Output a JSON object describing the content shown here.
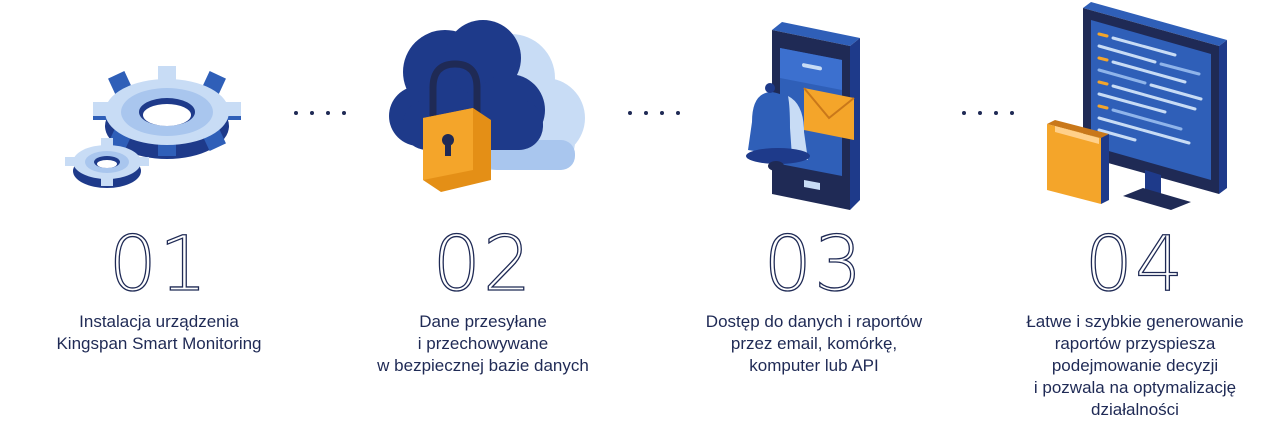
{
  "steps": [
    {
      "number": "01",
      "icon": "gears-icon",
      "lines": [
        "Instalacja urządzenia",
        "Kingspan Smart Monitoring"
      ]
    },
    {
      "number": "02",
      "icon": "cloud-lock-icon",
      "lines": [
        "Dane przesyłane",
        "i przechowywane",
        "w bezpiecznej bazie danych"
      ]
    },
    {
      "number": "03",
      "icon": "phone-notification-icon",
      "lines": [
        "Dostęp do danych i raportów",
        "przez email, komórkę,",
        "komputer lub API"
      ]
    },
    {
      "number": "04",
      "icon": "computer-report-icon",
      "lines": [
        "Łatwe i szybkie generowanie",
        "raportów przyspiesza",
        "podejmowanie decyzji",
        "i pozwala na optymalizację",
        "działalności"
      ]
    }
  ],
  "colors": {
    "navy": "#1f2a55",
    "dark_blue": "#1e3a8a",
    "mid_blue": "#2f5fb8",
    "light_blue": "#c8dcf5",
    "orange": "#f4a52a",
    "dots": "#1f2a55"
  }
}
